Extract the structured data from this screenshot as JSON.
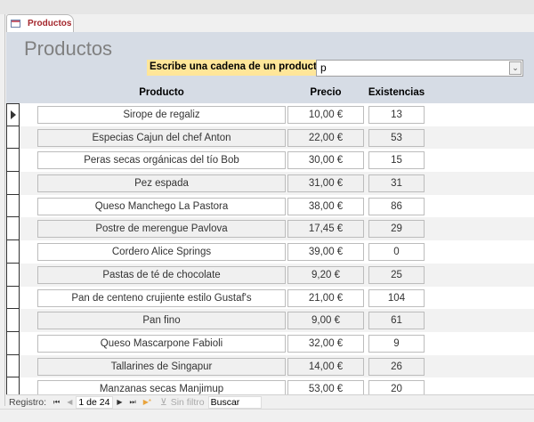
{
  "tab": {
    "label": "Productos"
  },
  "form": {
    "title": "Productos",
    "prompt": "Escribe una cadena de un producto",
    "search_value": "p"
  },
  "columns": {
    "product": "Producto",
    "price": "Precio",
    "stock": "Existencias"
  },
  "rows": [
    {
      "product": "Sirope de regaliz",
      "price": "10,00 €",
      "stock": "13"
    },
    {
      "product": "Especias Cajun del chef Anton",
      "price": "22,00 €",
      "stock": "53"
    },
    {
      "product": "Peras secas orgánicas del tío Bob",
      "price": "30,00 €",
      "stock": "15"
    },
    {
      "product": "Pez espada",
      "price": "31,00 €",
      "stock": "31"
    },
    {
      "product": "Queso Manchego La Pastora",
      "price": "38,00 €",
      "stock": "86"
    },
    {
      "product": "Postre de merengue Pavlova",
      "price": "17,45 €",
      "stock": "29"
    },
    {
      "product": "Cordero Alice Springs",
      "price": "39,00 €",
      "stock": "0"
    },
    {
      "product": "Pastas de té de chocolate",
      "price": "9,20 €",
      "stock": "25"
    },
    {
      "product": "Pan de centeno crujiente estilo Gustaf's",
      "price": "21,00 €",
      "stock": "104"
    },
    {
      "product": "Pan fino",
      "price": "9,00 €",
      "stock": "61"
    },
    {
      "product": "Queso Mascarpone Fabioli",
      "price": "32,00 €",
      "stock": "9"
    },
    {
      "product": "Tallarines de Singapur",
      "price": "14,00 €",
      "stock": "26"
    },
    {
      "product": "Manzanas secas Manjimup",
      "price": "53,00 €",
      "stock": "20"
    }
  ],
  "nav": {
    "label": "Registro:",
    "position": "1 de 24",
    "filter": "Sin filtro",
    "search": "Buscar"
  }
}
